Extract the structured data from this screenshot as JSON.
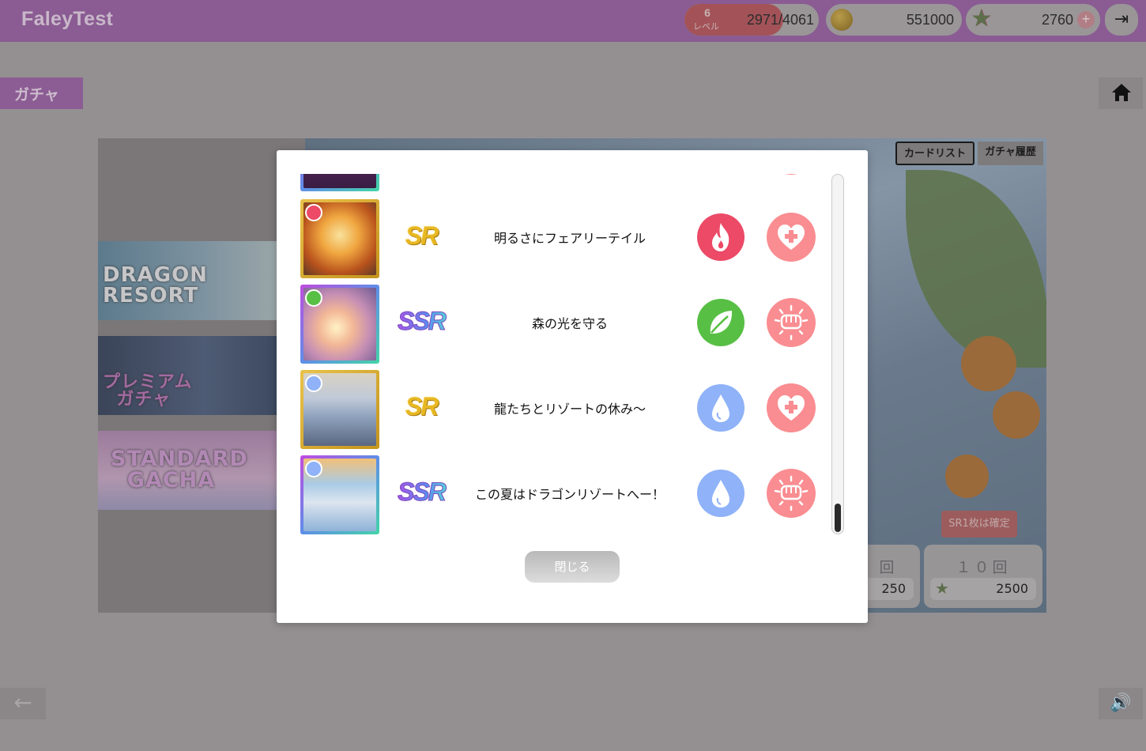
{
  "header": {
    "app_title": "FaleyTest",
    "level": {
      "value": "6",
      "label": "レベル",
      "exp": "2971/4061"
    },
    "coins": "551000",
    "stars": "2760",
    "stars_plus": "+",
    "logout_icon": "logout-icon"
  },
  "page": {
    "section_tag": "ガチャ",
    "back_icon": "←"
  },
  "gacha": {
    "banners": [
      {
        "text": "DRAGON\nRESORT"
      },
      {
        "text": "プレミアム\nガチャ"
      },
      {
        "text": "STANDARD\nGACHA"
      }
    ],
    "tabs": {
      "card_list": "カードリスト",
      "history": "ガチャ履歴"
    },
    "guarantee": "SR1枚は確定",
    "single": {
      "label": "回",
      "cost": "250"
    },
    "ten": {
      "label": "１０回",
      "cost": "2500"
    }
  },
  "modal": {
    "cards": [
      {
        "rarity": "SR",
        "name": "明るさにフェアリーテイル",
        "attribute": "fire",
        "role": "heal"
      },
      {
        "rarity": "SSR",
        "name": "森の光を守る",
        "attribute": "leaf",
        "role": "attack"
      },
      {
        "rarity": "SR",
        "name": "龍たちとリゾートの休み～",
        "attribute": "water",
        "role": "heal"
      },
      {
        "rarity": "SSR",
        "name": "この夏はドラゴンリゾートへー！",
        "attribute": "water",
        "role": "attack"
      }
    ],
    "close_label": "閉じる"
  },
  "colors": {
    "header_bg": "#8a5c93",
    "attr_fire": "#ec4a67",
    "attr_leaf": "#58bf45",
    "attr_water": "#8fb2f8",
    "role_bg": "#f98d91"
  }
}
